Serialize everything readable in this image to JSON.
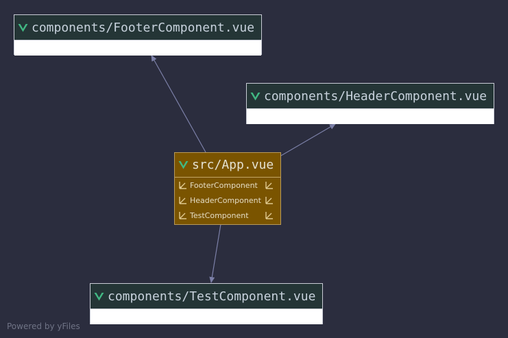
{
  "diagram": {
    "nodes": {
      "footer": {
        "title": "components/FooterComponent.vue",
        "icon": "vue-icon"
      },
      "header": {
        "title": "components/HeaderComponent.vue",
        "icon": "vue-icon"
      },
      "app": {
        "title": "src/App.vue",
        "icon": "vue-icon",
        "members": [
          {
            "label": "FooterComponent",
            "icon": "import-arrow-icon"
          },
          {
            "label": "HeaderComponent",
            "icon": "import-arrow-icon"
          },
          {
            "label": "TestComponent",
            "icon": "import-arrow-icon"
          }
        ]
      },
      "test": {
        "title": "components/TestComponent.vue",
        "icon": "vue-icon"
      }
    },
    "edges": [
      {
        "from": "src/App.vue",
        "to": "components/FooterComponent.vue"
      },
      {
        "from": "src/App.vue",
        "to": "components/HeaderComponent.vue"
      },
      {
        "from": "src/App.vue",
        "to": "components/TestComponent.vue"
      }
    ]
  },
  "watermark": "Powered by yFiles",
  "colors": {
    "background": "#2b2d3e",
    "node_header": "#243536",
    "app_node": "#7a5400",
    "vue_green": "#41b883",
    "edge": "#7c80a8"
  }
}
